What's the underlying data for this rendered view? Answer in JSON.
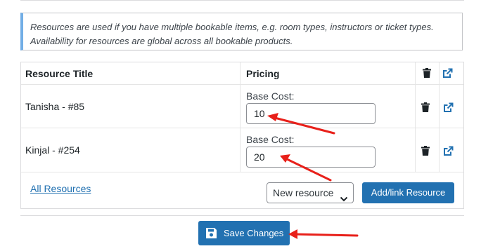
{
  "notice": {
    "line1": "Resources are used if you have multiple bookable items, e.g. room types, instructors or ticket types.",
    "line2": "Availability for resources are global across all bookable products."
  },
  "table": {
    "headers": {
      "title": "Resource Title",
      "pricing": "Pricing"
    },
    "rows": [
      {
        "title": "Tanisha - #85",
        "cost_label": "Base Cost:",
        "cost": "10"
      },
      {
        "title": "Kinjal - #254",
        "cost_label": "Base Cost:",
        "cost": "20"
      }
    ]
  },
  "footer": {
    "all_resources_link": "All Resources",
    "select_value": "New resource",
    "add_link_button": "Add/link Resource"
  },
  "save_button": "Save Changes",
  "colors": {
    "primary": "#2271b1",
    "annotation": "#e8201a",
    "notice_border": "#72aee6"
  },
  "icons": {
    "delete": "trash-icon",
    "open": "external-link-icon",
    "save": "floppy-disk-icon",
    "dropdown": "chevron-down-icon"
  }
}
